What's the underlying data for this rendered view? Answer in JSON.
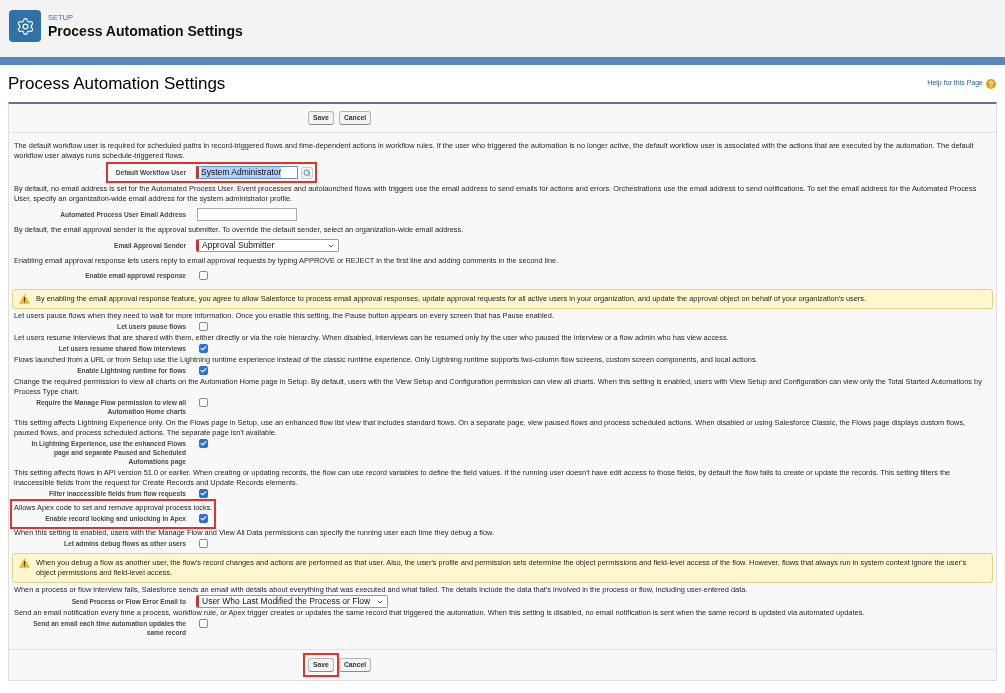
{
  "header": {
    "eyebrow": "SETUP",
    "title": "Process Automation Settings"
  },
  "page": {
    "title": "Process Automation Settings",
    "help_link": "Help for this Page"
  },
  "top_buttons": [
    {
      "label": "Save",
      "highlighted": false
    },
    {
      "label": "Cancel",
      "highlighted": false
    }
  ],
  "sections": [
    {
      "blocks": [
        {
          "kind": "paragraph",
          "text": "The default workflow user is required for scheduled paths in record-triggered flows and time-dependent actions in workflow rules. If the user who triggered the automation is no longer active, the default workflow user is associated with the actions that are executed by the automation. The default workflow user always runs schedule-triggered flows."
        },
        {
          "kind": "highlight",
          "items": [
            {
              "kind": "lookup",
              "label": "Default Workflow User",
              "value": "System Administrator",
              "required": true,
              "value_selected": true
            }
          ]
        },
        {
          "kind": "paragraph",
          "text": "By default, no email address is set for the Automated Process User. Event processes and autolaunched flows with triggers use the email address to send emails for actions and errors. Orchestrations use the email address to send notifications. To set the email address for the Automated Process User, specify an organization-wide email address for the system administrator profile."
        },
        {
          "kind": "text_input",
          "label": "Automated Process User Email Address",
          "required": false
        },
        {
          "kind": "paragraph",
          "text": "By default, the email approval sender is the approval submitter. To override the default sender, select an organization-wide email address."
        },
        {
          "kind": "select",
          "label": "Email Approval Sender",
          "value": "Approval Submitter",
          "required": true
        },
        {
          "kind": "paragraph",
          "text": "Enabling email approval response lets users reply to email approval requests by typing APPROVE or REJECT in the first line and adding comments in the second line."
        },
        {
          "kind": "checkbox",
          "label": "Enable email approval response",
          "checked": false
        }
      ]
    },
    {
      "blocks": [
        {
          "kind": "warning",
          "text": "By enabling the email approval response feature, you agree to allow Salesforce to process email approval responses, update approval requests for all active users in your organization, and update the approval object on behalf of your organization's users."
        },
        {
          "kind": "paragraph",
          "text": "Let users pause flows when they need to wait for more information. Once you enable this setting, the Pause button appears on every screen that has Pause enabled."
        },
        {
          "kind": "checkbox",
          "label": "Let users pause flows",
          "checked": false
        },
        {
          "kind": "paragraph",
          "text": "Let users resume interviews that are shared with them, either directly or via the role hierarchy. When disabled, interviews can be resumed only by the user who paused the interview or a flow admin who has view access."
        },
        {
          "kind": "checkbox",
          "label": "Let users resume shared flow interviews",
          "checked": true
        },
        {
          "kind": "paragraph",
          "text": "Flows launched from a URL or from Setup use the Lightning runtime experience instead of the classic runtime experience. Only Lightning runtime supports two-column flow screens, custom screen components, and local actions."
        },
        {
          "kind": "checkbox",
          "label": "Enable Lightning runtime for flows",
          "checked": true
        },
        {
          "kind": "paragraph",
          "text": "Change the required permission to view all charts on the Automation Home page in Setup. By default, users with the View Setup and Configuration permission can view all charts. When this setting is enabled, users with View Setup and Configuration can view only the Total Started Automations by Process Type chart."
        },
        {
          "kind": "checkbox",
          "label": "Require the Manage Flow permission to view all Automation Home charts",
          "checked": false
        },
        {
          "kind": "paragraph",
          "text": "This setting affects Lightning Experience only. On the Flows page in Setup, use an enhanced flow list view that includes standard flows. On a separate page, view paused flows and process scheduled actions. When disabled or using Salesforce Classic, the Flows page displays custom flows, paused flows, and process scheduled actions. The separate page isn't available."
        },
        {
          "kind": "checkbox",
          "label": "In Lightning Experience, use the enhanced Flows page and separate Paused and Scheduled Automations page",
          "checked": true
        },
        {
          "kind": "paragraph",
          "text": "This setting affects flows in API version 51.0 or earlier. When creating or updating records, the flow can use record variables to define the field values. If the running user doesn't have edit access to those fields, by default the flow fails to create or update the records. This setting filters the inaccessible fields from the request for Create Records and Update Records elements."
        },
        {
          "kind": "checkbox",
          "label": "Filter inaccessible fields from flow requests",
          "checked": true
        },
        {
          "kind": "highlight",
          "items": [
            {
              "kind": "paragraph",
              "text": "Allows Apex code to set and remove approval process locks."
            },
            {
              "kind": "checkbox",
              "label": "Enable record locking and unlocking in Apex",
              "checked": true
            }
          ]
        },
        {
          "kind": "paragraph",
          "text": "When this setting is enabled, users with the Manage Flow and View All Data permissions can specify the running user each time they debug a flow."
        },
        {
          "kind": "checkbox",
          "label": "Let admins debug flows as other users",
          "checked": false
        },
        {
          "kind": "warning",
          "text": "When you debug a flow as another user, the flow's record changes and actions are performed as that user. Also, the user's profile and permission sets determine the object permissions and field-level access of the flow. However, flows that always run in system context ignore the user's object permissions and field-level access."
        },
        {
          "kind": "paragraph",
          "text": "When a process or flow interview fails, Salesforce sends an email with details about everything that was executed and what failed. The details include the data that's involved in the process or flow, including user-entered data."
        },
        {
          "kind": "select",
          "label": "Send Process or Flow Error Email to",
          "value": "User Who Last Modified the Process or Flow",
          "required": true
        },
        {
          "kind": "paragraph",
          "text": "Send an email notification every time a process, workflow rule, or Apex trigger creates or updates the same record that triggered the automation. When this setting is disabled, no email notification is sent when the same record is updated via automated updates."
        },
        {
          "kind": "checkbox",
          "label": "Send an email each time automation updates the same record",
          "checked": false
        }
      ]
    }
  ],
  "bottom_buttons": [
    {
      "label": "Save",
      "highlighted": true
    },
    {
      "label": "Cancel",
      "highlighted": false
    }
  ]
}
